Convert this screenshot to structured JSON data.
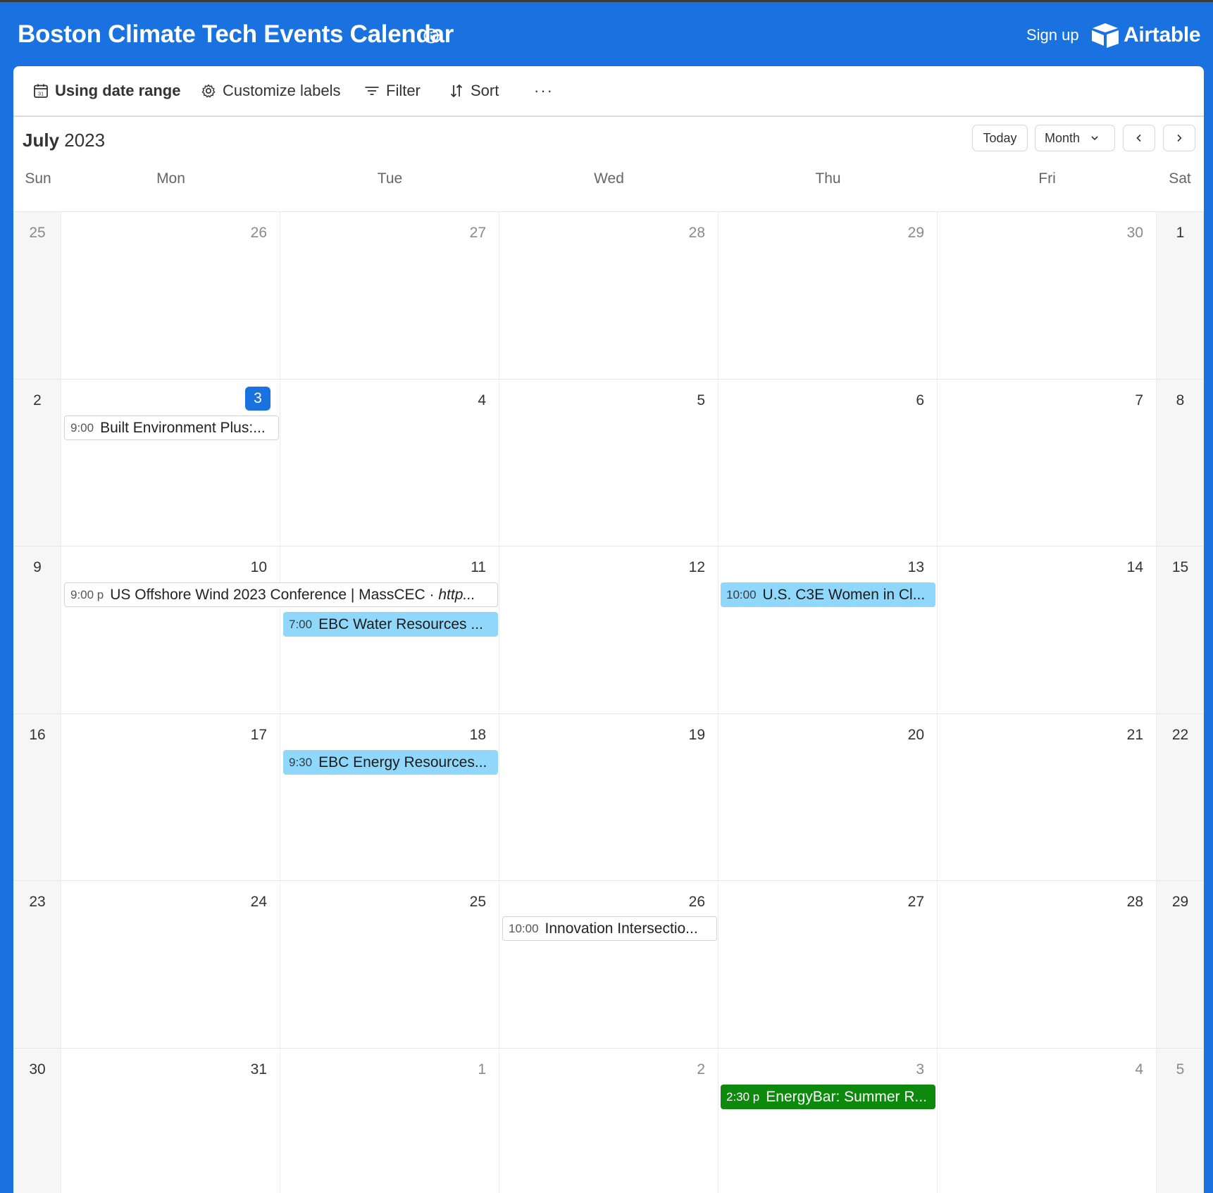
{
  "header": {
    "title": "Boston Climate Tech Events Calendar",
    "signup": "Sign up",
    "brand": "Airtable"
  },
  "toolbar": {
    "date_range": "Using date range",
    "customize": "Customize labels",
    "filter": "Filter",
    "sort": "Sort",
    "more": "···"
  },
  "calendar": {
    "month": "July",
    "year": "2023",
    "today_label": "Today",
    "view_label": "Month",
    "weekdays": [
      "Sun",
      "Mon",
      "Tue",
      "Wed",
      "Thu",
      "Fri",
      "Sat"
    ],
    "weeks": [
      [
        "25",
        "26",
        "27",
        "28",
        "29",
        "30",
        "1"
      ],
      [
        "2",
        "3",
        "4",
        "5",
        "6",
        "7",
        "8"
      ],
      [
        "9",
        "10",
        "11",
        "12",
        "13",
        "14",
        "15"
      ],
      [
        "16",
        "17",
        "18",
        "19",
        "20",
        "21",
        "22"
      ],
      [
        "23",
        "24",
        "25",
        "26",
        "27",
        "28",
        "29"
      ],
      [
        "30",
        "31",
        "1",
        "2",
        "3",
        "4",
        "5"
      ]
    ]
  },
  "events": [
    {
      "time": "9:00",
      "title": "Built Environment Plus:...",
      "suffix": ""
    },
    {
      "time": "9:00 p",
      "title": "US Offshore Wind 2023 Conference | MassCEC · ",
      "suffix": "http..."
    },
    {
      "time": "7:00",
      "title": "EBC Water Resources ...",
      "suffix": ""
    },
    {
      "time": "10:00",
      "title": "U.S. C3E Women in Cl...",
      "suffix": ""
    },
    {
      "time": "9:30",
      "title": "EBC Energy Resources...",
      "suffix": ""
    },
    {
      "time": "10:00",
      "title": "Innovation Intersectio...",
      "suffix": ""
    },
    {
      "time": "2:30 p",
      "title": "EnergyBar: Summer R...",
      "suffix": ""
    }
  ],
  "colors": {
    "header_bg": "#1a72e0",
    "today_badge": "#1a72e0",
    "event_blue": "#8fd8fb",
    "event_green": "#0d8a0d"
  },
  "icons": {
    "info": "info-icon",
    "brand": "airtable-logo-icon",
    "date_range": "calendar-icon",
    "customize": "gear-icon",
    "filter": "filter-icon",
    "sort": "sort-icon",
    "view_toggle": "chevron-down-icon",
    "prev": "chevron-left-icon",
    "next": "chevron-right-icon"
  }
}
